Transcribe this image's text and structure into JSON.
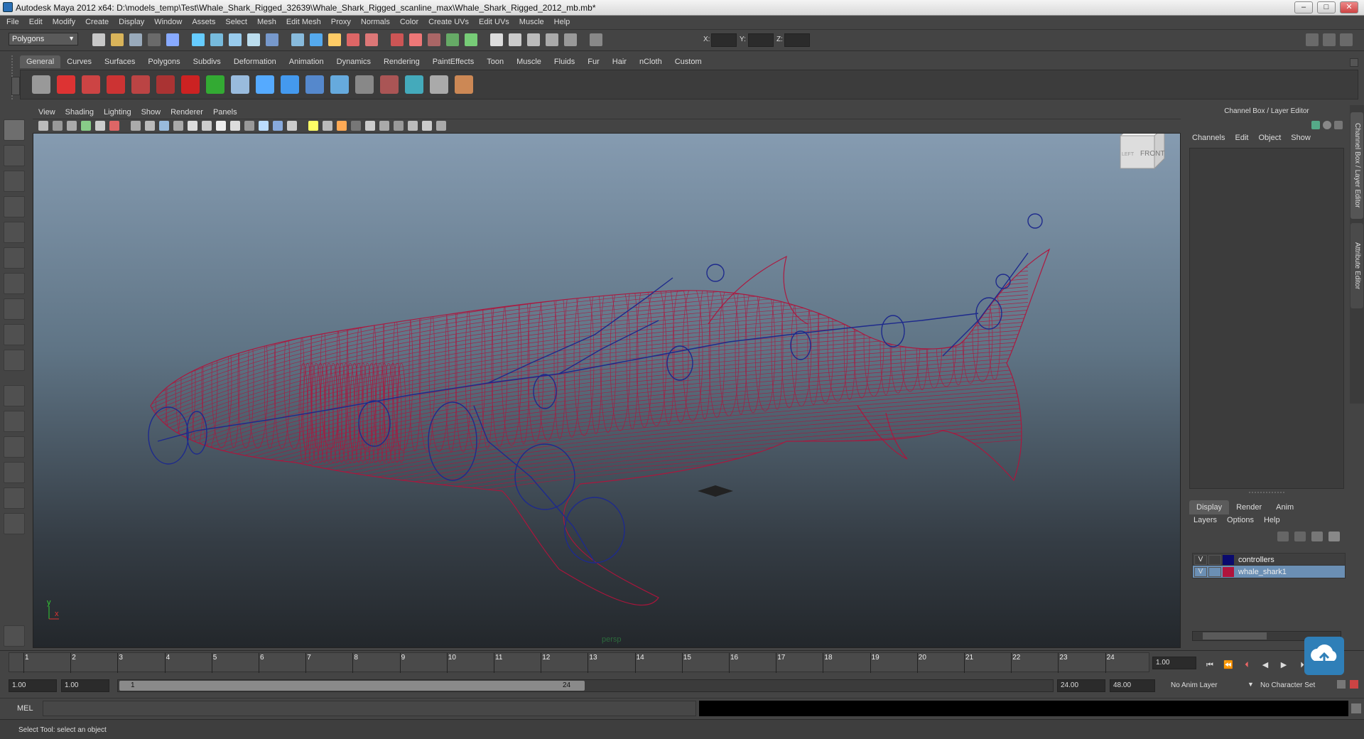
{
  "window": {
    "title": "Autodesk Maya 2012 x64: D:\\models_temp\\Test\\Whale_Shark_Rigged_32639\\Whale_Shark_Rigged_scanline_max\\Whale_Shark_Rigged_2012_mb.mb*",
    "minimize_glyph": "–",
    "maximize_glyph": "□",
    "close_glyph": "✕"
  },
  "menubar": [
    "File",
    "Edit",
    "Modify",
    "Create",
    "Display",
    "Window",
    "Assets",
    "Select",
    "Mesh",
    "Edit Mesh",
    "Proxy",
    "Normals",
    "Color",
    "Create UVs",
    "Edit UVs",
    "Muscle",
    "Help"
  ],
  "statusline": {
    "mode": "Polygons",
    "x_label": "X:",
    "y_label": "Y:",
    "z_label": "Z:"
  },
  "shelf": {
    "tabs": [
      "General",
      "Curves",
      "Surfaces",
      "Polygons",
      "Subdivs",
      "Deformation",
      "Animation",
      "Dynamics",
      "Rendering",
      "PaintEffects",
      "Toon",
      "Muscle",
      "Fluids",
      "Fur",
      "Hair",
      "nCloth",
      "Custom"
    ],
    "active_tab": "General"
  },
  "panel": {
    "menus": [
      "View",
      "Shading",
      "Lighting",
      "Show",
      "Renderer",
      "Panels"
    ],
    "camera_label": "persp",
    "viewcube_label": "FRONT",
    "viewcube_side_label": "LEFT",
    "axis_y": "y",
    "axis_x": "x"
  },
  "channel_box": {
    "header": "Channel Box / Layer Editor",
    "menus": [
      "Channels",
      "Edit",
      "Object",
      "Show"
    ]
  },
  "layer_editor": {
    "tabs": [
      "Display",
      "Render",
      "Anim"
    ],
    "active_tab": "Display",
    "menus": [
      "Layers",
      "Options",
      "Help"
    ],
    "layers": [
      {
        "visible": "V",
        "name": "controllers",
        "color": "#0a0a6e",
        "selected": false
      },
      {
        "visible": "V",
        "name": "whale_shark1",
        "color": "#b0143c",
        "selected": true
      }
    ]
  },
  "side_tabs": [
    "Channel Box / Layer Editor",
    "Attribute Editor"
  ],
  "time_slider": {
    "ticks": [
      "1",
      "2",
      "3",
      "4",
      "5",
      "6",
      "7",
      "8",
      "9",
      "10",
      "11",
      "12",
      "13",
      "14",
      "15",
      "16",
      "17",
      "18",
      "19",
      "20",
      "21",
      "22",
      "23",
      "24"
    ],
    "current_time": "1.00"
  },
  "range_slider": {
    "start_time": "1.00",
    "playback_start": "1.00",
    "range_start_label": "1",
    "range_end_label": "24",
    "playback_end": "24.00",
    "end_time": "48.00",
    "anim_layer": "No Anim Layer",
    "character_set": "No Character Set"
  },
  "command_line": {
    "label": "MEL"
  },
  "help_line": {
    "text": "Select Tool: select an object"
  },
  "colors": {
    "wireframe": "#b0143c",
    "joints": "#1e2a8c",
    "viewport_top": "#8aa0b6",
    "viewport_bottom": "#23272b"
  }
}
